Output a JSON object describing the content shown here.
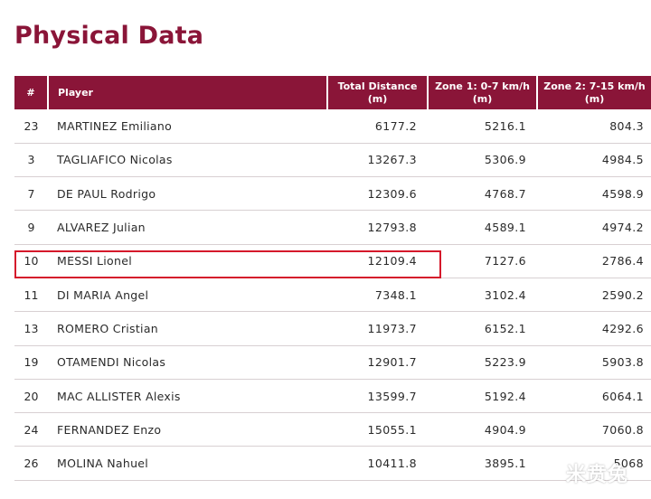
{
  "title": "Physical Data",
  "headers": {
    "num": "#",
    "player": "Player",
    "total_line1": "Total Distance",
    "total_line2": "(m)",
    "zone1_line1": "Zone 1: 0-7 km/h",
    "zone1_line2": "(m)",
    "zone2_line1": "Zone 2: 7-15 km/h",
    "zone2_line2": "(m)"
  },
  "rows": [
    {
      "num": "23",
      "player": "MARTINEZ Emiliano",
      "total": "6177.2",
      "zone1": "5216.1",
      "zone2": "804.3"
    },
    {
      "num": "3",
      "player": "TAGLIAFICO Nicolas",
      "total": "13267.3",
      "zone1": "5306.9",
      "zone2": "4984.5"
    },
    {
      "num": "7",
      "player": "DE PAUL Rodrigo",
      "total": "12309.6",
      "zone1": "4768.7",
      "zone2": "4598.9"
    },
    {
      "num": "9",
      "player": "ALVAREZ Julian",
      "total": "12793.8",
      "zone1": "4589.1",
      "zone2": "4974.2"
    },
    {
      "num": "10",
      "player": "MESSI Lionel",
      "total": "12109.4",
      "zone1": "7127.6",
      "zone2": "2786.4"
    },
    {
      "num": "11",
      "player": "DI MARIA Angel",
      "total": "7348.1",
      "zone1": "3102.4",
      "zone2": "2590.2"
    },
    {
      "num": "13",
      "player": "ROMERO Cristian",
      "total": "11973.7",
      "zone1": "6152.1",
      "zone2": "4292.6"
    },
    {
      "num": "19",
      "player": "OTAMENDI Nicolas",
      "total": "12901.7",
      "zone1": "5223.9",
      "zone2": "5903.8"
    },
    {
      "num": "20",
      "player": "MAC ALLISTER Alexis",
      "total": "13599.7",
      "zone1": "5192.4",
      "zone2": "6064.1"
    },
    {
      "num": "24",
      "player": "FERNANDEZ Enzo",
      "total": "15055.1",
      "zone1": "4904.9",
      "zone2": "7060.8"
    },
    {
      "num": "26",
      "player": "MOLINA Nahuel",
      "total": "10411.8",
      "zone1": "3895.1",
      "zone2": "5068"
    }
  ],
  "watermark": "米贲兔",
  "colors": {
    "brand": "#8a1538",
    "highlight": "#d5192b"
  }
}
